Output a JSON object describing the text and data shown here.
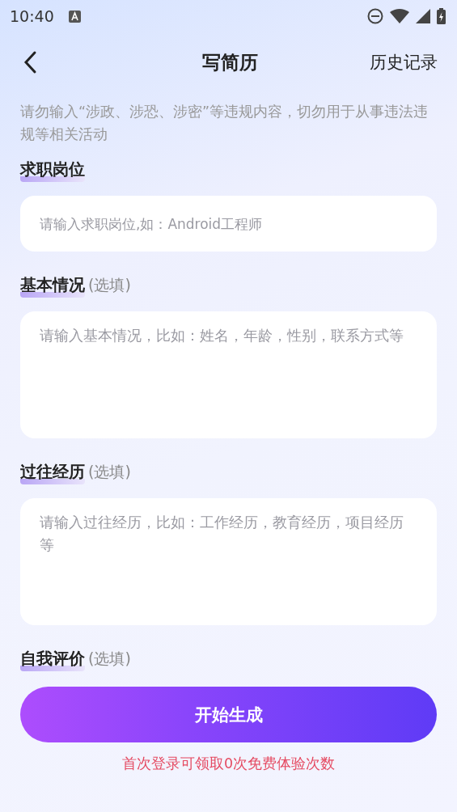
{
  "status_bar": {
    "time": "10:40"
  },
  "header": {
    "title": "写简历",
    "action": "历史记录"
  },
  "notice": "请勿输入“涉政、涉恐、涉密”等违规内容，切勿用于从事违法违规等相关活动",
  "sections": [
    {
      "label": "求职岗位",
      "kind": "input",
      "placeholder": "请输入求职岗位,如：Android工程师"
    },
    {
      "label": "基本情况",
      "optional": "(选填)",
      "kind": "textarea",
      "placeholder": "请输入基本情况，比如：姓名，年龄，性别，联系方式等"
    },
    {
      "label": "过往经历",
      "optional": "(选填)",
      "kind": "textarea",
      "placeholder": "请输入过往经历，比如：工作经历，教育经历，项目经历等"
    },
    {
      "label": "自我评价",
      "optional": "(选填)",
      "kind": "none"
    }
  ],
  "generate_button": "开始生成",
  "footnote": "首次登录可领取0次免费体验次数"
}
